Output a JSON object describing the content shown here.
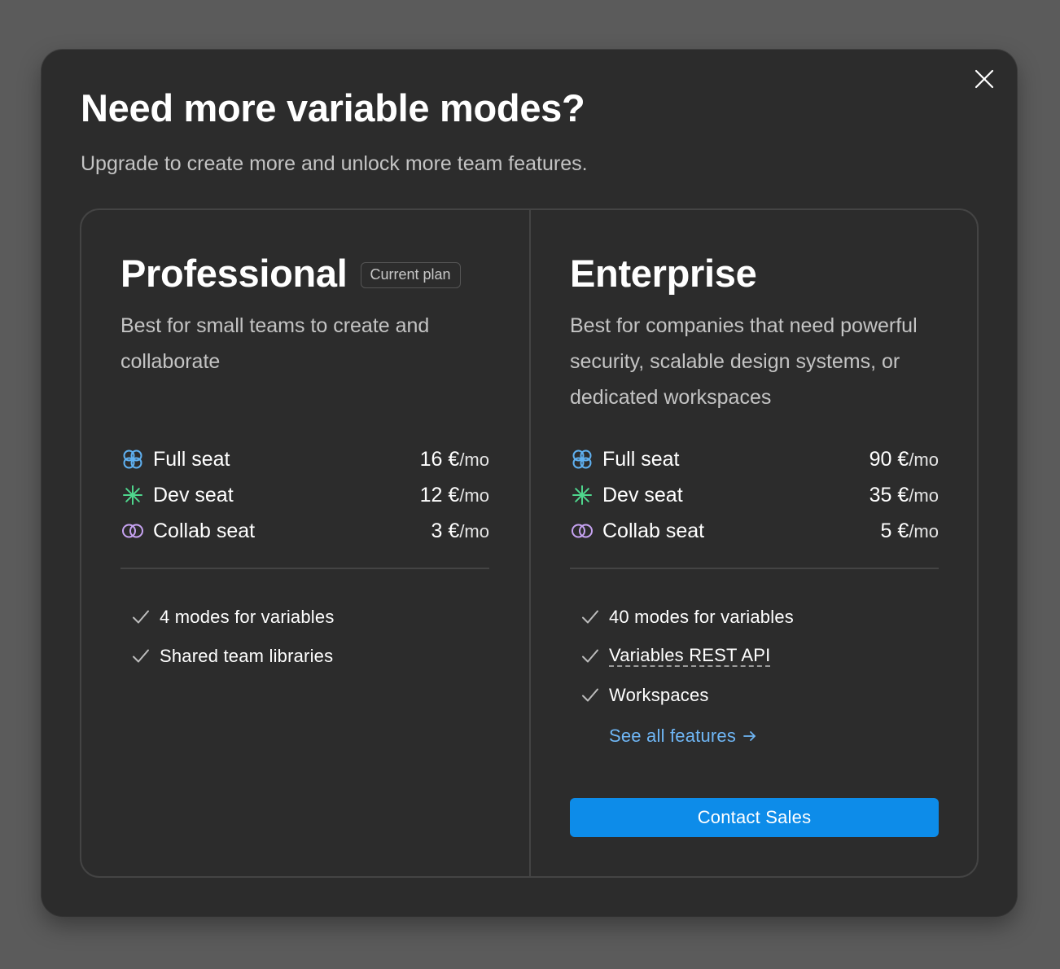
{
  "dialog": {
    "title": "Need more variable modes?",
    "subtitle": "Upgrade to create more and unlock more team features."
  },
  "colors": {
    "accent": "#0d8ce9",
    "link": "#6fb6f5",
    "full_seat_icon": "#5fb0f0",
    "dev_seat_icon": "#4fd68d",
    "collab_seat_icon": "#c7a3f2"
  },
  "plans": [
    {
      "name": "Professional",
      "badge": "Current plan",
      "description": "Best for small teams to create and collaborate",
      "seats": [
        {
          "icon": "full-seat-icon",
          "label": "Full seat",
          "price": "16 €",
          "unit": "/mo"
        },
        {
          "icon": "dev-seat-icon",
          "label": "Dev seat",
          "price": "12 €",
          "unit": "/mo"
        },
        {
          "icon": "collab-seat-icon",
          "label": "Collab seat",
          "price": "3 €",
          "unit": "/mo"
        }
      ],
      "features": [
        "4 modes for variables",
        "Shared team libraries"
      ]
    },
    {
      "name": "Enterprise",
      "description": "Best for companies that need powerful security, scalable design systems, or dedicated workspaces",
      "seats": [
        {
          "icon": "full-seat-icon",
          "label": "Full seat",
          "price": "90 €",
          "unit": "/mo"
        },
        {
          "icon": "dev-seat-icon",
          "label": "Dev seat",
          "price": "35 €",
          "unit": "/mo"
        },
        {
          "icon": "collab-seat-icon",
          "label": "Collab seat",
          "price": "5 €",
          "unit": "/mo"
        }
      ],
      "features": [
        "40 modes for variables",
        "Variables REST API",
        "Workspaces"
      ],
      "see_all_link": "See all features",
      "cta_label": "Contact Sales"
    }
  ]
}
